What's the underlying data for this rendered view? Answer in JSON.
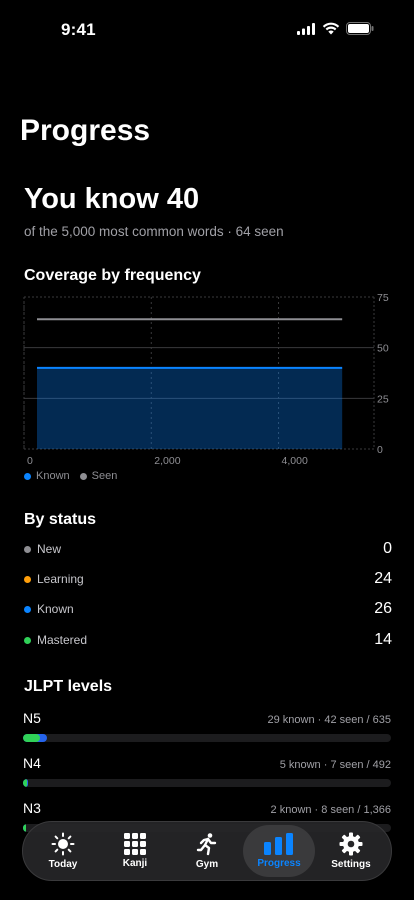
{
  "status_bar": {
    "time": "9:41"
  },
  "page": {
    "title": "Progress"
  },
  "summary": {
    "headline": "You know 40",
    "subline": "of the 5,000 most common words · 64 seen"
  },
  "coverage": {
    "title": "Coverage by frequency",
    "legend": [
      {
        "label": "Known",
        "color": "#0a84ff"
      },
      {
        "label": "Seen",
        "color": "#8e8e93"
      }
    ]
  },
  "chart_data": {
    "type": "area",
    "title": "Coverage by frequency",
    "x_ticks": [
      "0",
      "2,000",
      "4,000"
    ],
    "y_ticks": [
      "0",
      "25",
      "50",
      "75"
    ],
    "xlim": [
      0,
      5500
    ],
    "ylim": [
      0,
      75
    ],
    "series": [
      {
        "name": "Known",
        "x": [
          0,
          5000
        ],
        "y": [
          40,
          40
        ],
        "color": "#0a84ff"
      },
      {
        "name": "Seen",
        "x": [
          0,
          5000
        ],
        "y": [
          64,
          64
        ],
        "color": "#8e8e93"
      }
    ]
  },
  "by_status": {
    "title": "By status",
    "items": [
      {
        "label": "New",
        "count": "0",
        "color": "#8e8e93"
      },
      {
        "label": "Learning",
        "count": "24",
        "color": "#ff9f0a"
      },
      {
        "label": "Known",
        "count": "26",
        "color": "#0a84ff"
      },
      {
        "label": "Mastered",
        "count": "14",
        "color": "#30d158"
      }
    ]
  },
  "jlpt": {
    "title": "JLPT levels",
    "levels": [
      {
        "name": "N5",
        "stats": "29 known · 42 seen / 635",
        "known_fraction": 0.0457,
        "seen_fraction": 0.0661
      },
      {
        "name": "N4",
        "stats": "5 known · 7 seen / 492",
        "known_fraction": 0.0102,
        "seen_fraction": 0.0142
      },
      {
        "name": "N3",
        "stats": "2 known · 8 seen / 1,366",
        "known_fraction": 0.0015,
        "seen_fraction": 0.0059
      }
    ]
  },
  "tabs": [
    {
      "label": "Today",
      "icon": "sun-icon",
      "active": false
    },
    {
      "label": "Kanji",
      "icon": "grid-icon",
      "active": false
    },
    {
      "label": "Gym",
      "icon": "runner-icon",
      "active": false
    },
    {
      "label": "Progress",
      "icon": "bar-chart-icon",
      "active": true
    },
    {
      "label": "Settings",
      "icon": "gear-icon",
      "active": false
    }
  ]
}
